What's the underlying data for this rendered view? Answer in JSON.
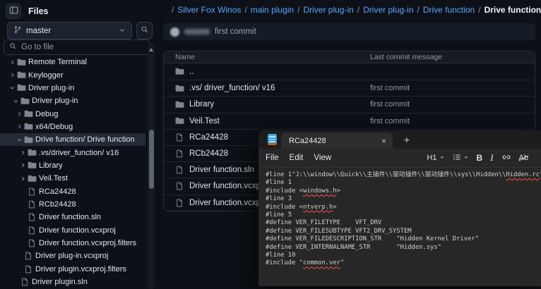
{
  "sidebar": {
    "title": "Files",
    "branch_label": "master",
    "goto_placeholder": "Go to file",
    "tree": [
      {
        "label": "Remote Terminal",
        "depth": 1,
        "kind": "folder",
        "expanded": false
      },
      {
        "label": "Keylogger",
        "depth": 1,
        "kind": "folder",
        "expanded": false
      },
      {
        "label": "Driver plug-in",
        "depth": 1,
        "kind": "folder",
        "expanded": true
      },
      {
        "label": "Driver plug-in",
        "depth": 2,
        "kind": "folder",
        "expanded": true
      },
      {
        "label": "Debug",
        "depth": 3,
        "kind": "folder",
        "expanded": false
      },
      {
        "label": "x64/Debug",
        "depth": 3,
        "kind": "folder",
        "expanded": false
      },
      {
        "label": "Drive function/ Drive function",
        "depth": 3,
        "kind": "folder",
        "expanded": true,
        "selected": true
      },
      {
        "label": ".vs/driver_function/ v16",
        "depth": 4,
        "kind": "folder",
        "expanded": false
      },
      {
        "label": "Library",
        "depth": 4,
        "kind": "folder",
        "expanded": false
      },
      {
        "label": "Veil.Test",
        "depth": 4,
        "kind": "folder",
        "expanded": false
      },
      {
        "label": "RCa24428",
        "depth": 4,
        "kind": "file"
      },
      {
        "label": "RCb24428",
        "depth": 4,
        "kind": "file"
      },
      {
        "label": "Driver function.sln",
        "depth": 4,
        "kind": "file"
      },
      {
        "label": "Driver function.vcxproj",
        "depth": 4,
        "kind": "file"
      },
      {
        "label": "Driver function.vcxproj.filters",
        "depth": 4,
        "kind": "file"
      },
      {
        "label": "Driver plug-in.vcxproj",
        "depth": 3,
        "kind": "file"
      },
      {
        "label": "Driver plugin.vcxproj.filters",
        "depth": 3,
        "kind": "file"
      },
      {
        "label": "Driver plugin.sln",
        "depth": 2,
        "kind": "file"
      }
    ]
  },
  "breadcrumb": {
    "repo_redacted": true,
    "links": [
      "Silver Fox Winos",
      "main plugin",
      "Driver plug-in",
      "Driver plug-in",
      "Drive function"
    ],
    "current": "Drive function",
    "separator": "/"
  },
  "commit_bar": {
    "author_redacted": true,
    "message": "first commit"
  },
  "file_table": {
    "columns": [
      "Name",
      "Last commit message"
    ],
    "rows": [
      {
        "name": "..",
        "kind": "folder",
        "message": ""
      },
      {
        "name": ".vs/ driver_function/ v16",
        "kind": "folder",
        "message": "first commit"
      },
      {
        "name": "Library",
        "kind": "folder",
        "message": "first commit"
      },
      {
        "name": "Veil.Test",
        "kind": "folder",
        "message": "first commit"
      },
      {
        "name": "RCa24428",
        "kind": "file",
        "message": ""
      },
      {
        "name": "RCb24428",
        "kind": "file",
        "message": ""
      },
      {
        "name": "Driver function.sln",
        "kind": "file",
        "message": ""
      },
      {
        "name": "Driver function.vcxproj",
        "kind": "file",
        "message": ""
      },
      {
        "name": "Driver function.vcxproj.filters",
        "kind": "file",
        "message": ""
      }
    ]
  },
  "editor": {
    "tab_title": "RCa24428",
    "tab_close": "×",
    "new_tab": "+",
    "menus": [
      "File",
      "Edit",
      "View"
    ],
    "toolbar": {
      "heading": "H1",
      "bold": "B",
      "italic": "I",
      "clear": "Ab"
    },
    "code_lines": [
      [
        {
          "t": "#line 1\"J:\\\\window\\\\Quick\\\\主插件\\\\驱动插件\\\\驱动插件\\\\sys\\\\Hidden\\\\"
        },
        {
          "t": "Hidden.rc",
          "err": true
        },
        {
          "t": "\""
        }
      ],
      [
        {
          "t": "#line 1"
        }
      ],
      [
        {
          "t": "#include <"
        },
        {
          "t": "windows.h",
          "err": true
        },
        {
          "t": ">"
        }
      ],
      [
        {
          "t": "#line 3"
        }
      ],
      [
        {
          "t": "#include <"
        },
        {
          "t": "ntverp.h",
          "err": true
        },
        {
          "t": ">"
        }
      ],
      [
        {
          "t": "#line 5"
        }
      ],
      [
        {
          "t": "#define VER_FILETYPE    VFT_DRV"
        }
      ],
      [
        {
          "t": "#define VER_FILESUBTYPE VFT2_DRV_SYSTEM"
        }
      ],
      [
        {
          "t": "#define VER_FILEDESCRIPTION_STR    \"Hidden Kernel Driver\""
        }
      ],
      [
        {
          "t": "#define VER_INTERNALNAME_STR       \"Hidden.sys\""
        }
      ],
      [
        {
          "t": "#line 10"
        }
      ],
      [
        {
          "t": "#include \""
        },
        {
          "t": "common.ver",
          "err": true
        },
        {
          "t": "\""
        }
      ]
    ]
  },
  "colors": {
    "page_background": "#0d1117",
    "link_blue": "#58a6ff",
    "error_underline_red": "#ff5244",
    "selected_row": "#242b36",
    "editor_background": "#272727",
    "notepad_icon_blue": "#2fa3dd",
    "notepad_icon_orange": "#a9672c"
  }
}
